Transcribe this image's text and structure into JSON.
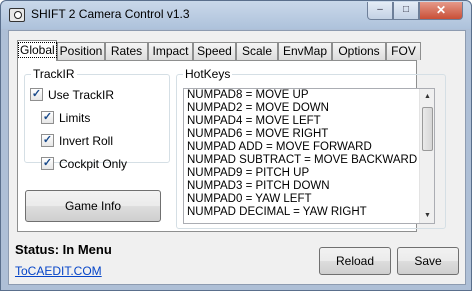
{
  "window": {
    "title": "SHIFT 2 Camera Control v1.3",
    "controls": {
      "minimize": "–",
      "maximize": "□",
      "close": "✕"
    }
  },
  "tabs": [
    {
      "label": "Global",
      "active": true
    },
    {
      "label": "Position"
    },
    {
      "label": "Rates"
    },
    {
      "label": "Impact"
    },
    {
      "label": "Speed"
    },
    {
      "label": "Scale"
    },
    {
      "label": "EnvMap"
    },
    {
      "label": "Options"
    },
    {
      "label": "FOV"
    }
  ],
  "trackir": {
    "group_label": "TrackIR",
    "use_trackir": {
      "label": "Use TrackIR",
      "checked": true
    },
    "limits": {
      "label": "Limits",
      "checked": true
    },
    "invert_roll": {
      "label": "Invert Roll",
      "checked": true
    },
    "cockpit_only": {
      "label": "Cockpit Only",
      "checked": true
    },
    "check_glyph": "✓"
  },
  "game_info_button": "Game Info",
  "hotkeys": {
    "group_label": "HotKeys",
    "items": [
      "NUMPAD8 = MOVE UP",
      "NUMPAD2 = MOVE DOWN",
      "NUMPAD4 = MOVE LEFT",
      "NUMPAD6 = MOVE RIGHT",
      "NUMPAD ADD = MOVE FORWARD",
      "NUMPAD SUBTRACT = MOVE BACKWARD",
      "NUMPAD9 = PITCH UP",
      "NUMPAD3 = PITCH DOWN",
      "NUMPAD0 = YAW LEFT",
      "NUMPAD DECIMAL = YAW RIGHT"
    ],
    "scroll_up": "▲",
    "scroll_down": "▼"
  },
  "status": "Status: In Menu",
  "link": "ToCAEDIT.COM",
  "reload_button": "Reload",
  "save_button": "Save"
}
